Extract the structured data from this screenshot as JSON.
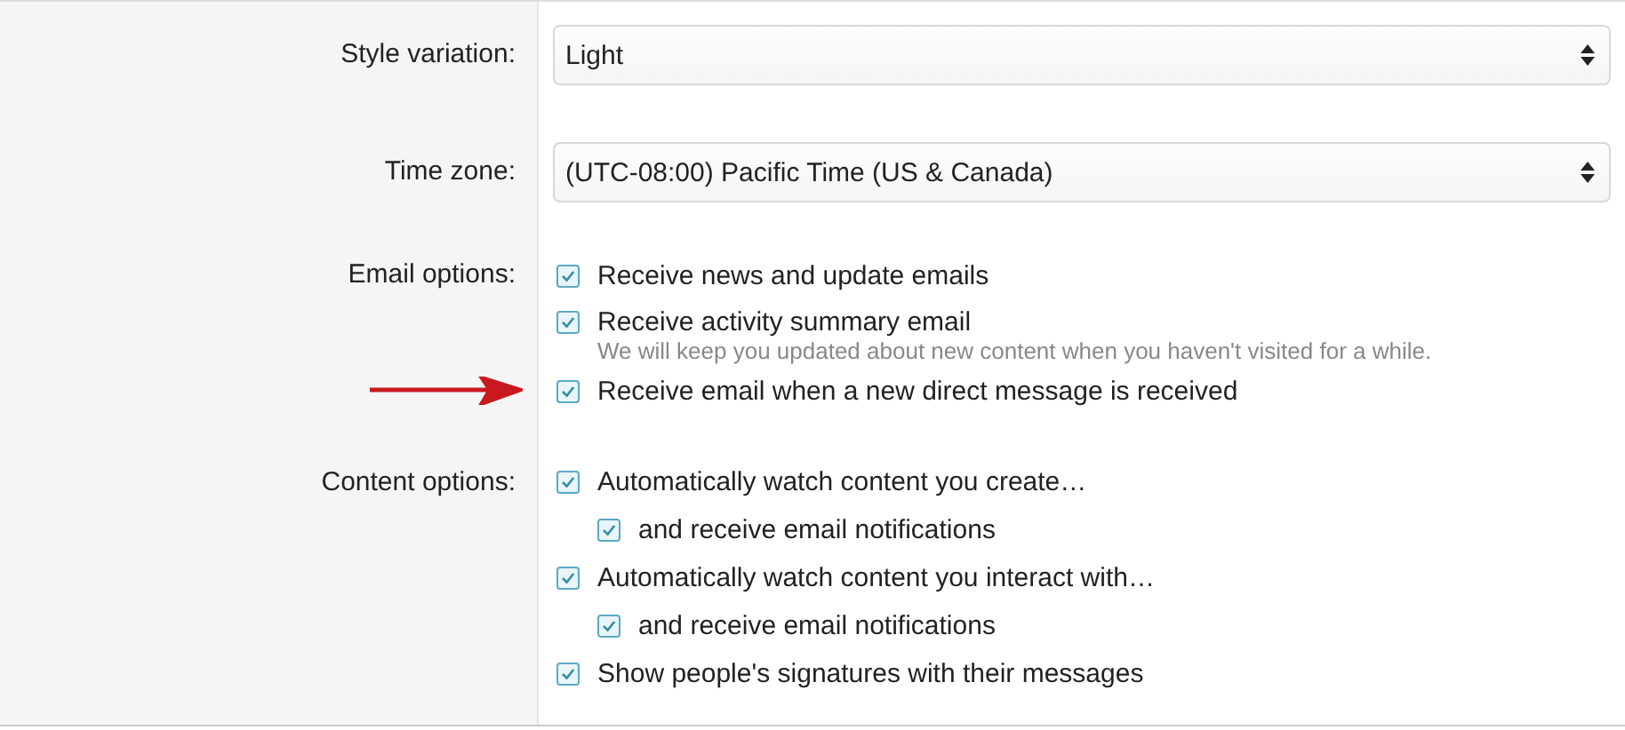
{
  "settings": [
    {
      "kind": "select",
      "label": "Style variation:",
      "value": "Light"
    },
    {
      "kind": "select",
      "label": "Time zone:",
      "value": "(UTC-08:00) Pacific Time (US & Canada)"
    },
    {
      "kind": "checks",
      "label": "Email options:",
      "options": [
        {
          "label": "Receive news and update emails",
          "checked": true
        },
        {
          "label": "Receive activity summary email",
          "checked": true,
          "hint": "We will keep you updated about new content when you haven't visited for a while."
        },
        {
          "label": "Receive email when a new direct message is received",
          "checked": true,
          "arrow": true
        }
      ]
    },
    {
      "kind": "checks",
      "label": "Content options:",
      "options": [
        {
          "label": "Automatically watch content you create…",
          "checked": true,
          "children": [
            {
              "label": "and receive email notifications",
              "checked": true
            }
          ]
        },
        {
          "label": "Automatically watch content you interact with…",
          "checked": true,
          "children": [
            {
              "label": "and receive email notifications",
              "checked": true
            }
          ]
        },
        {
          "label": "Show people's signatures with their messages",
          "checked": true
        }
      ]
    }
  ]
}
